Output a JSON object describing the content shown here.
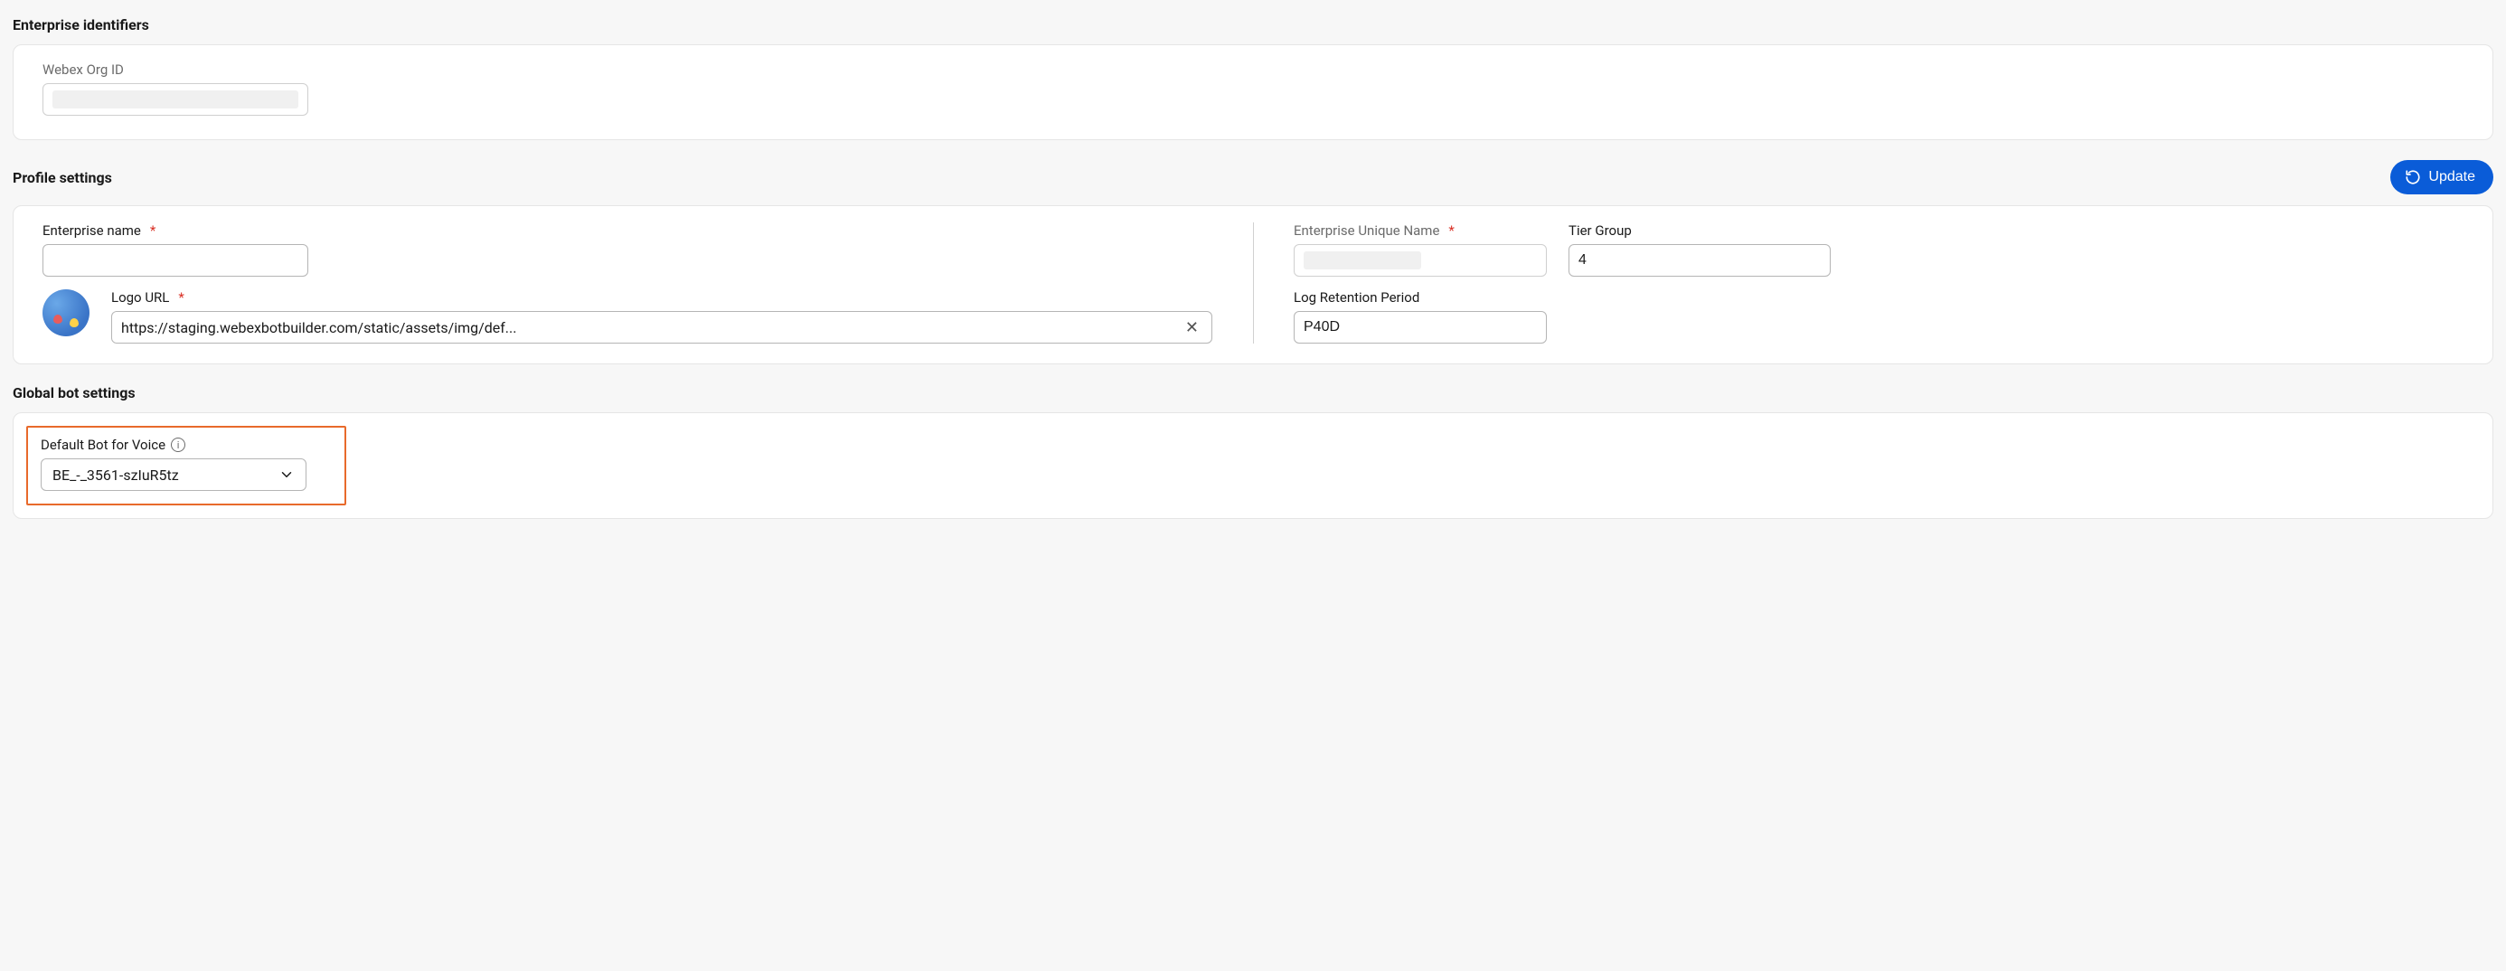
{
  "sections": {
    "enterprise_identifiers": {
      "title": "Enterprise identifiers",
      "webex_org_id": {
        "label": "Webex Org ID",
        "value": ""
      }
    },
    "profile_settings": {
      "title": "Profile settings",
      "update_button": "Update",
      "enterprise_name": {
        "label": "Enterprise name",
        "value": ""
      },
      "logo_url": {
        "label": "Logo URL",
        "value": "https://staging.webexbotbuilder.com/static/assets/img/def..."
      },
      "enterprise_unique_name": {
        "label": "Enterprise Unique Name",
        "value": ""
      },
      "tier_group": {
        "label": "Tier Group",
        "value": "4"
      },
      "log_retention_period": {
        "label": "Log Retention Period",
        "value": "P40D"
      }
    },
    "global_bot_settings": {
      "title": "Global bot settings",
      "default_bot_voice": {
        "label": "Default Bot for Voice",
        "selected": "BE_-_3561-szIuR5tz"
      }
    }
  }
}
